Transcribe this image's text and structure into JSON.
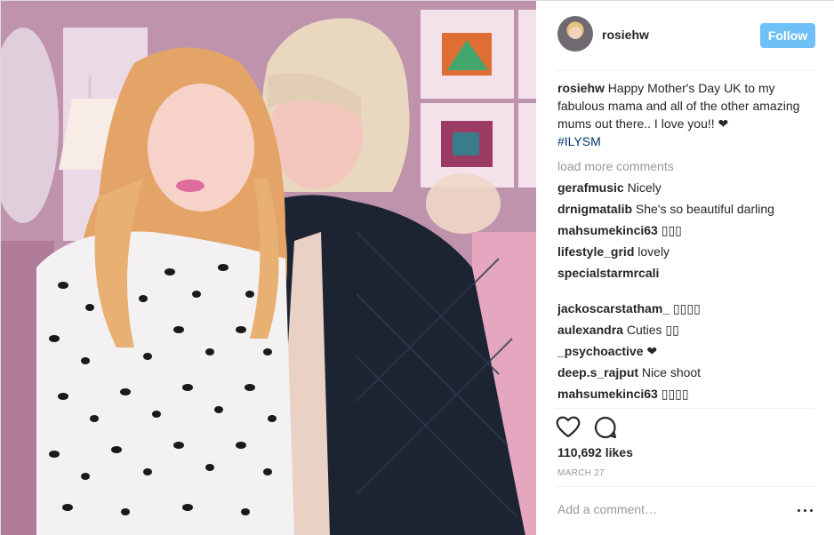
{
  "post": {
    "username": "rosiehw",
    "follow_label": "Follow",
    "caption_user": "rosiehw",
    "caption_text": "Happy Mother's Day UK to my fabulous mama and all of the other amazing mums out there.. I love you!! ❤",
    "hashtag": "#ILYSM",
    "load_more": "load more comments",
    "comments": [
      {
        "user": "gerafmusic",
        "text": "Nicely"
      },
      {
        "user": "drnigmatalib",
        "text": "She's so beautiful darling"
      },
      {
        "user": "mahsumekinci63",
        "text": "▯▯▯"
      },
      {
        "user": "lifestyle_grid",
        "text": "lovely"
      },
      {
        "user": "specialstarmrcali",
        "text": ""
      },
      {
        "user": "jackoscarstatham_",
        "text": "▯▯▯▯"
      },
      {
        "user": "aulexandra",
        "text": "Cuties ▯▯"
      },
      {
        "user": "_psychoactive",
        "text": "❤"
      },
      {
        "user": "deep.s_rajput",
        "text": "Nice shoot"
      },
      {
        "user": "mahsumekinci63",
        "text": "▯▯▯▯"
      }
    ],
    "likes": "110,692 likes",
    "date": "MARCH 27",
    "add_comment_placeholder": "Add a comment…"
  },
  "icons": {
    "like": "heart-outline-icon",
    "comment": "speech-bubble-icon",
    "more": "more-options-icon"
  },
  "colors": {
    "follow_button": "#70c0f8",
    "hashtag": "#003569",
    "muted_text": "#999999"
  }
}
